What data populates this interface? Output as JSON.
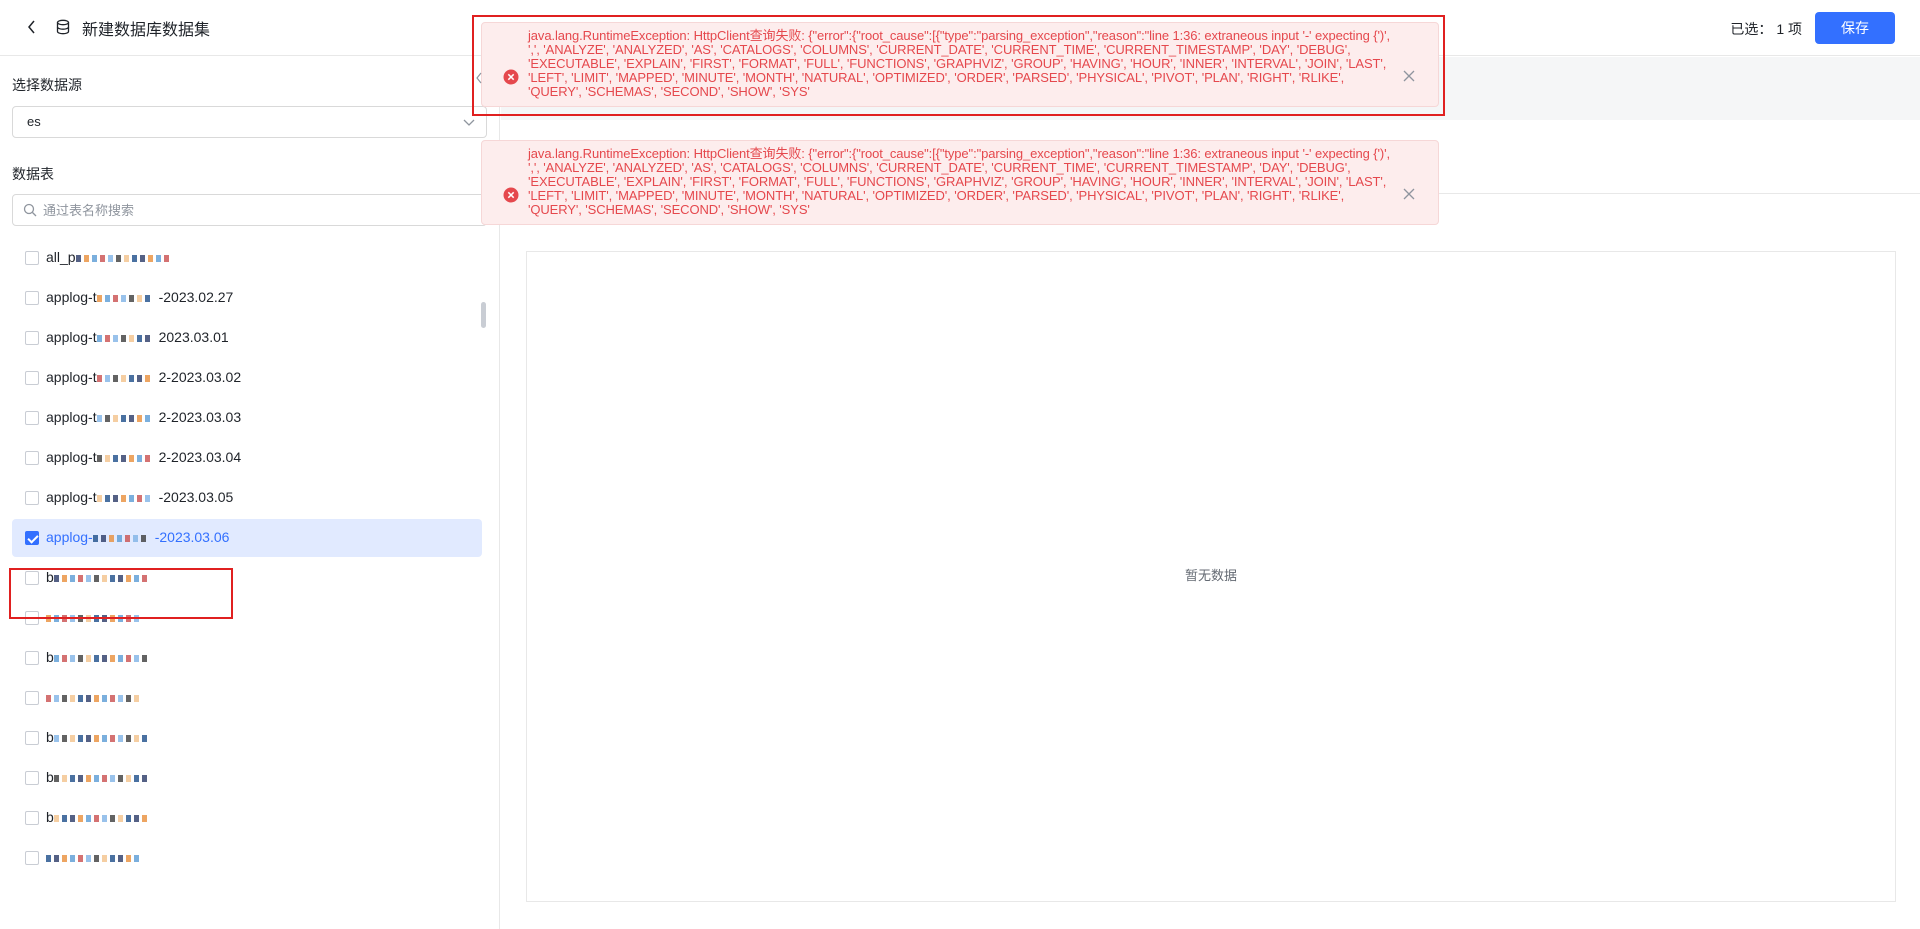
{
  "header": {
    "title": "新建数据库数据集",
    "selected_label": "已选：",
    "selected_value": "1 项",
    "save_label": "保存"
  },
  "sidebar": {
    "datasource_label": "选择数据源",
    "datasource_value": "es",
    "tables_label": "数据表",
    "search_placeholder": "通过表名称搜索",
    "tables": [
      {
        "name": "all_p",
        "checked": false
      },
      {
        "name": "applog-t",
        "suffix": "-2023.02.27",
        "checked": false
      },
      {
        "name": "applog-t",
        "suffix": "2023.03.01",
        "checked": false
      },
      {
        "name": "applog-t",
        "suffix": "2-2023.03.02",
        "checked": false
      },
      {
        "name": "applog-t",
        "suffix": "2-2023.03.03",
        "checked": false
      },
      {
        "name": "applog-t",
        "suffix": "2-2023.03.04",
        "checked": false
      },
      {
        "name": "applog-t",
        "suffix": "-2023.03.05",
        "checked": false
      },
      {
        "name": "applog-",
        "suffix": "-2023.03.06",
        "checked": true
      },
      {
        "name": "b",
        "checked": false
      },
      {
        "name": "",
        "checked": false
      },
      {
        "name": "b",
        "checked": false
      },
      {
        "name": "",
        "checked": false
      },
      {
        "name": "b",
        "checked": false
      },
      {
        "name": "b",
        "checked": false
      },
      {
        "name": "b",
        "checked": false
      },
      {
        "name": "",
        "checked": false
      }
    ]
  },
  "main": {
    "empty_text": "暂无数据"
  },
  "errors": [
    {
      "message": "java.lang.RuntimeException: HttpClient查询失败: {\"error\":{\"root_cause\":[{\"type\":\"parsing_exception\",\"reason\":\"line 1:36: extraneous input '-' expecting {')', ',', 'ANALYZE', 'ANALYZED', 'AS', 'CATALOGS', 'COLUMNS', 'CURRENT_DATE', 'CURRENT_TIME', 'CURRENT_TIMESTAMP', 'DAY', 'DEBUG', 'EXECUTABLE', 'EXPLAIN', 'FIRST', 'FORMAT', 'FULL', 'FUNCTIONS', 'GRAPHVIZ', 'GROUP', 'HAVING', 'HOUR', 'INNER', 'INTERVAL', 'JOIN', 'LAST', 'LEFT', 'LIMIT', 'MAPPED', 'MINUTE', 'MONTH', 'NATURAL', 'OPTIMIZED', 'ORDER', 'PARSED', 'PHYSICAL', 'PIVOT', 'PLAN', 'RIGHT', 'RLIKE', 'QUERY', 'SCHEMAS', 'SECOND', 'SHOW', 'SYS'"
    },
    {
      "message": "java.lang.RuntimeException: HttpClient查询失败: {\"error\":{\"root_cause\":[{\"type\":\"parsing_exception\",\"reason\":\"line 1:36: extraneous input '-' expecting {')', ',', 'ANALYZE', 'ANALYZED', 'AS', 'CATALOGS', 'COLUMNS', 'CURRENT_DATE', 'CURRENT_TIME', 'CURRENT_TIMESTAMP', 'DAY', 'DEBUG', 'EXECUTABLE', 'EXPLAIN', 'FIRST', 'FORMAT', 'FULL', 'FUNCTIONS', 'GRAPHVIZ', 'GROUP', 'HAVING', 'HOUR', 'INNER', 'INTERVAL', 'JOIN', 'LAST', 'LEFT', 'LIMIT', 'MAPPED', 'MINUTE', 'MONTH', 'NATURAL', 'OPTIMIZED', 'ORDER', 'PARSED', 'PHYSICAL', 'PIVOT', 'PLAN', 'RIGHT', 'RLIKE', 'QUERY', 'SCHEMAS', 'SECOND', 'SHOW', 'SYS'"
    }
  ],
  "colors": {
    "accent": "#3370ff",
    "error_text": "#e5484d",
    "error_bg": "#fdeded",
    "annotation_red": "#e02020"
  },
  "icons": {
    "back": "chevron-left-icon",
    "database": "database-icon",
    "select": "chevron-down-icon",
    "search": "search-icon",
    "error": "error-circle-icon",
    "close": "close-icon"
  }
}
